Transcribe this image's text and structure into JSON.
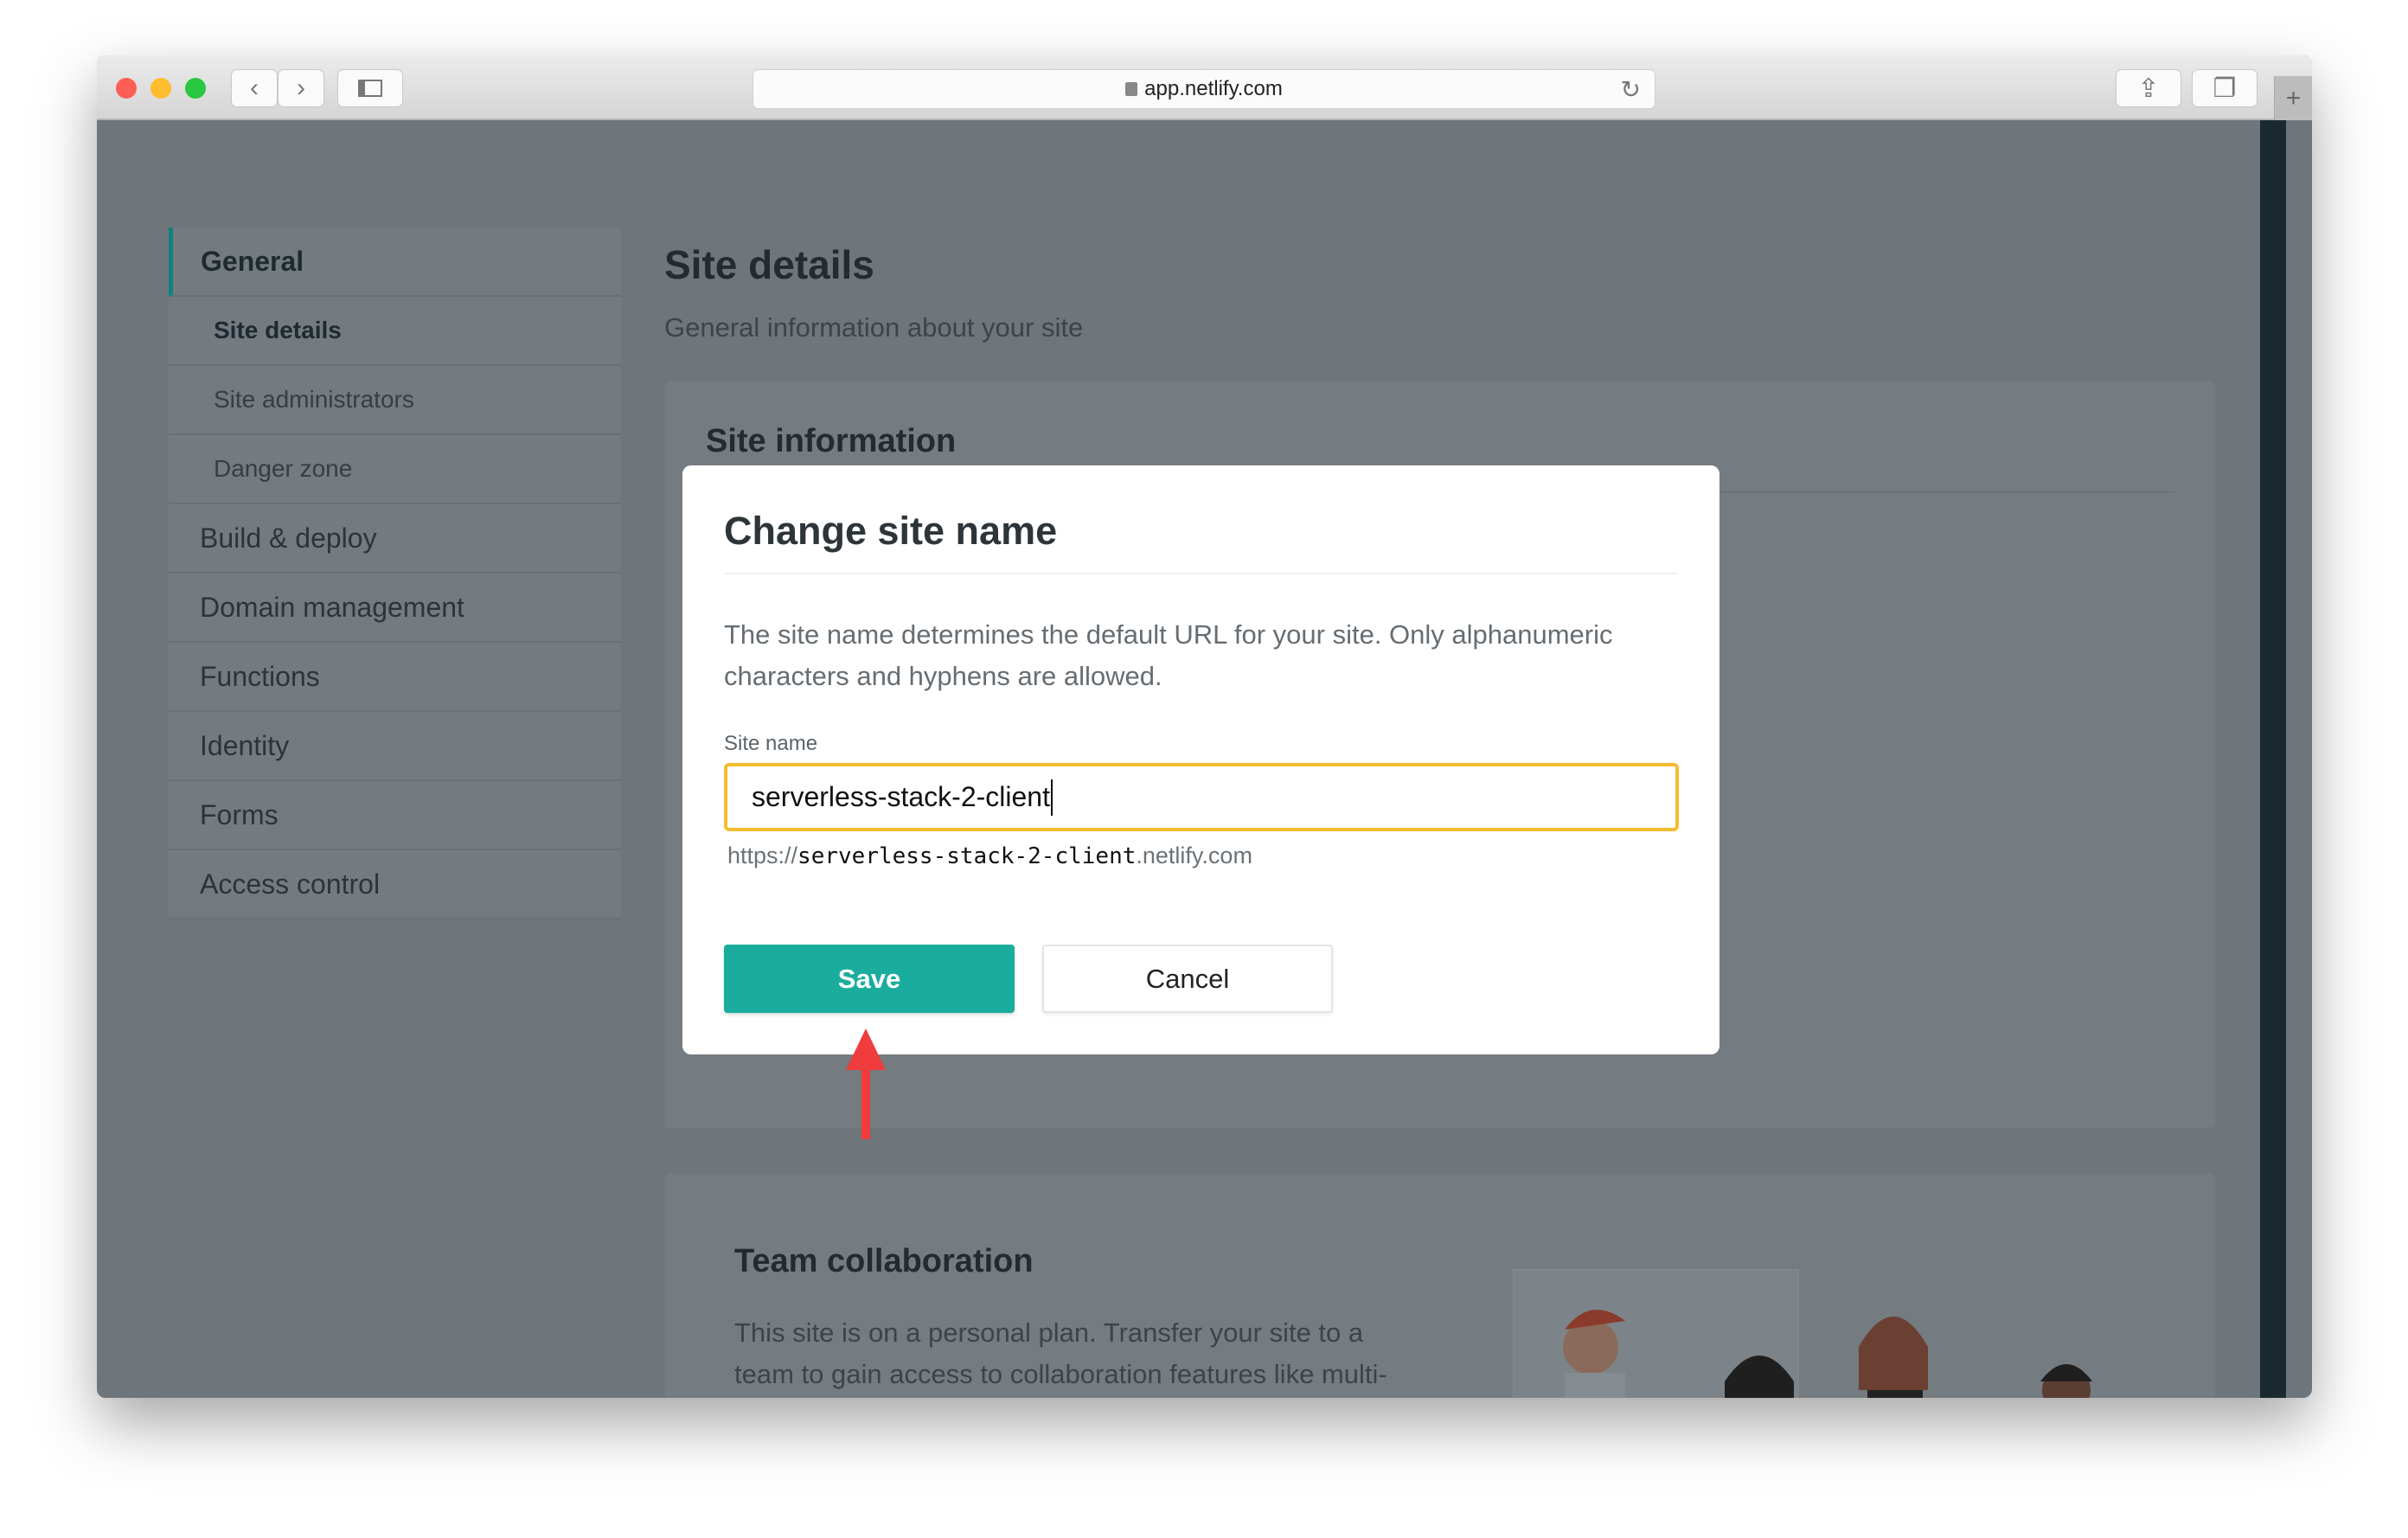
{
  "browser": {
    "url": "app.netlify.com"
  },
  "sidebar": {
    "items": [
      {
        "label": "General",
        "type": "section",
        "active": true
      },
      {
        "label": "Site details",
        "type": "sub",
        "active": true
      },
      {
        "label": "Site administrators",
        "type": "sub"
      },
      {
        "label": "Danger zone",
        "type": "sub"
      },
      {
        "label": "Build & deploy",
        "type": "section"
      },
      {
        "label": "Domain management",
        "type": "section"
      },
      {
        "label": "Functions",
        "type": "section"
      },
      {
        "label": "Identity",
        "type": "section"
      },
      {
        "label": "Forms",
        "type": "section"
      },
      {
        "label": "Access control",
        "type": "section"
      }
    ]
  },
  "page": {
    "title": "Site details",
    "subtitle": "General information about your site",
    "site_info_title": "Site information",
    "team": {
      "title": "Team collaboration",
      "text": "This site is on a personal plan. Transfer your site to a team to gain access to collaboration features like multi-level administrator roles and visitor access control."
    }
  },
  "modal": {
    "title": "Change site name",
    "description": "The site name determines the default URL for your site. Only alphanumeric characters and hyphens are allowed.",
    "field_label": "Site name",
    "field_value": "serverless-stack-2-client",
    "url_prefix": "https://",
    "url_name": "serverless-stack-2-client",
    "url_suffix": ".netlify.com",
    "save_label": "Save",
    "cancel_label": "Cancel"
  },
  "colors": {
    "accent": "#1aad9e",
    "focus": "#f4bc2e",
    "annotation_arrow": "#f03c3c"
  }
}
